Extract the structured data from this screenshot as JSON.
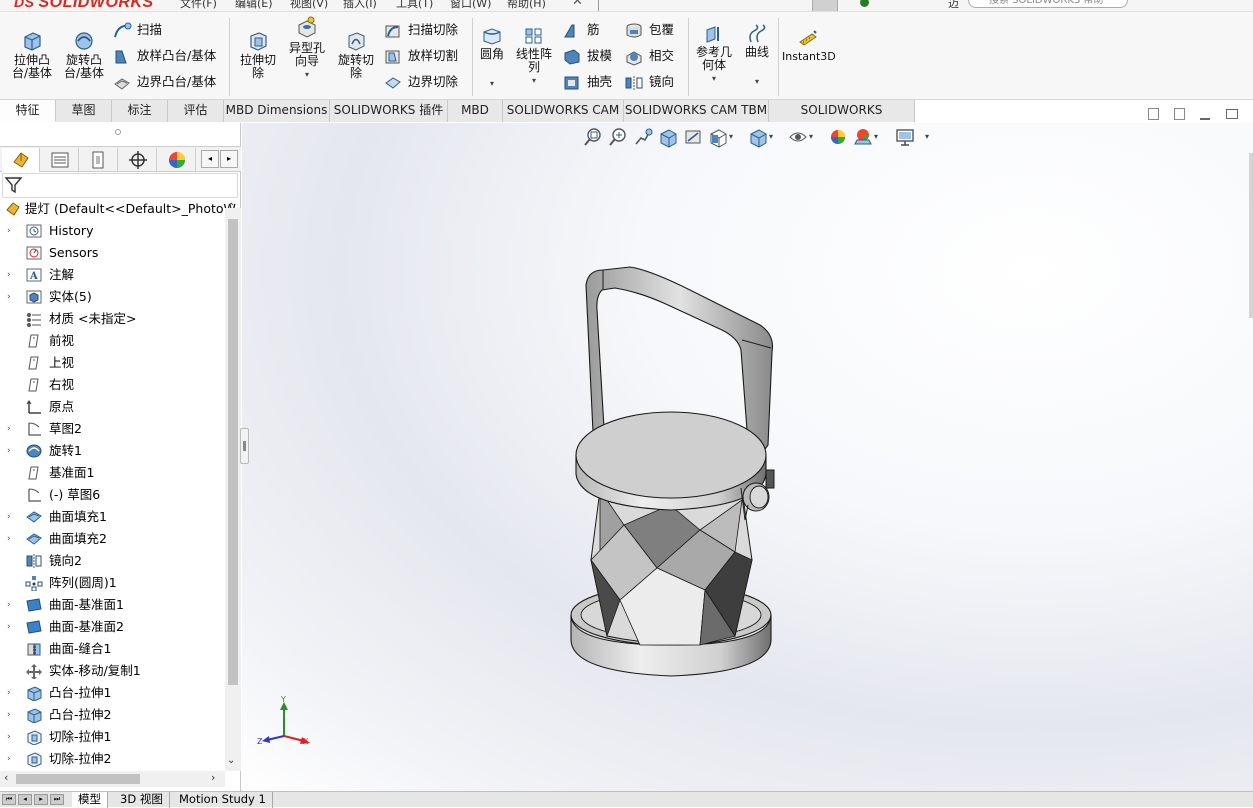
{
  "app": {
    "logo": "SOLIDWORKS",
    "logo_prefix": "DS"
  },
  "menu": [
    "文件(F)",
    "编辑(E)",
    "视图(V)",
    "插入(I)",
    "工具(T)",
    "窗口(W)",
    "帮助(H)"
  ],
  "search": {
    "placeholder": "搜索 SOLIDWORKS 帮助",
    "prefix": "迈"
  },
  "ribbon": {
    "extrude_boss": "拉伸凸台/基体",
    "revolve_boss": "旋转凸台/基体",
    "sweep": "扫描",
    "loft_boss": "放样凸台/基体",
    "boundary_boss": "边界凸台/基体",
    "extrude_cut": "拉伸切除",
    "hole_wizard": "异型孔向导",
    "revolve_cut": "旋转切除",
    "sweep_cut": "扫描切除",
    "loft_cut": "放样切割",
    "boundary_cut": "边界切除",
    "fillet": "圆角",
    "linear_pattern": "线性阵列",
    "rib": "筋",
    "draft": "拔模",
    "shell": "抽壳",
    "wrap": "包覆",
    "intersect": "相交",
    "mirror": "镜向",
    "ref_geometry": "参考几何体",
    "curves": "曲线",
    "instant3d": "Instant3D"
  },
  "tabs": [
    "特征",
    "草图",
    "标注",
    "评估",
    "MBD Dimensions",
    "SOLIDWORKS 插件",
    "MBD",
    "SOLIDWORKS CAM",
    "SOLIDWORKS CAM TBM",
    "SOLIDWORKS Inspection"
  ],
  "tree": {
    "root": "提灯  (Default<<Default>_PhotoW",
    "items": [
      {
        "label": "History",
        "arrow": "›",
        "icon": "history-icon"
      },
      {
        "label": "Sensors",
        "arrow": "",
        "icon": "sensor-icon"
      },
      {
        "label": "注解",
        "arrow": "›",
        "icon": "annotation-icon"
      },
      {
        "label": "实体(5)",
        "arrow": "›",
        "icon": "solid-bodies-icon"
      },
      {
        "label": "材质 <未指定>",
        "arrow": "",
        "icon": "material-icon"
      },
      {
        "label": "前视",
        "arrow": "",
        "icon": "plane-icon"
      },
      {
        "label": "上视",
        "arrow": "",
        "icon": "plane-icon"
      },
      {
        "label": "右视",
        "arrow": "",
        "icon": "plane-icon"
      },
      {
        "label": "原点",
        "arrow": "",
        "icon": "origin-icon"
      },
      {
        "label": "草图2",
        "arrow": "›",
        "icon": "sketch-icon"
      },
      {
        "label": "旋转1",
        "arrow": "›",
        "icon": "revolve-icon"
      },
      {
        "label": "基准面1",
        "arrow": "",
        "icon": "plane-icon"
      },
      {
        "label": "(-) 草图6",
        "arrow": "",
        "icon": "sketch-icon"
      },
      {
        "label": "曲面填充1",
        "arrow": "›",
        "icon": "surface-fill-icon"
      },
      {
        "label": "曲面填充2",
        "arrow": "›",
        "icon": "surface-fill-icon"
      },
      {
        "label": "镜向2",
        "arrow": "",
        "icon": "mirror-icon"
      },
      {
        "label": "阵列(圆周)1",
        "arrow": "",
        "icon": "circular-pattern-icon"
      },
      {
        "label": "曲面-基准面1",
        "arrow": "›",
        "icon": "planar-surface-icon"
      },
      {
        "label": "曲面-基准面2",
        "arrow": "›",
        "icon": "planar-surface-icon"
      },
      {
        "label": "曲面-缝合1",
        "arrow": "",
        "icon": "knit-icon"
      },
      {
        "label": "实体-移动/复制1",
        "arrow": "",
        "icon": "move-copy-icon"
      },
      {
        "label": "凸台-拉伸1",
        "arrow": "›",
        "icon": "extrude-icon"
      },
      {
        "label": "凸台-拉伸2",
        "arrow": "›",
        "icon": "extrude-icon"
      },
      {
        "label": "切除-拉伸1",
        "arrow": "›",
        "icon": "cut-extrude-icon"
      },
      {
        "label": "切除-拉伸2",
        "arrow": "›",
        "icon": "cut-extrude-icon"
      }
    ]
  },
  "triad": {
    "x": "X",
    "y": "Y",
    "z": "Z"
  },
  "bottom_tabs": [
    "模型",
    "3D 视图",
    "Motion Study 1"
  ]
}
